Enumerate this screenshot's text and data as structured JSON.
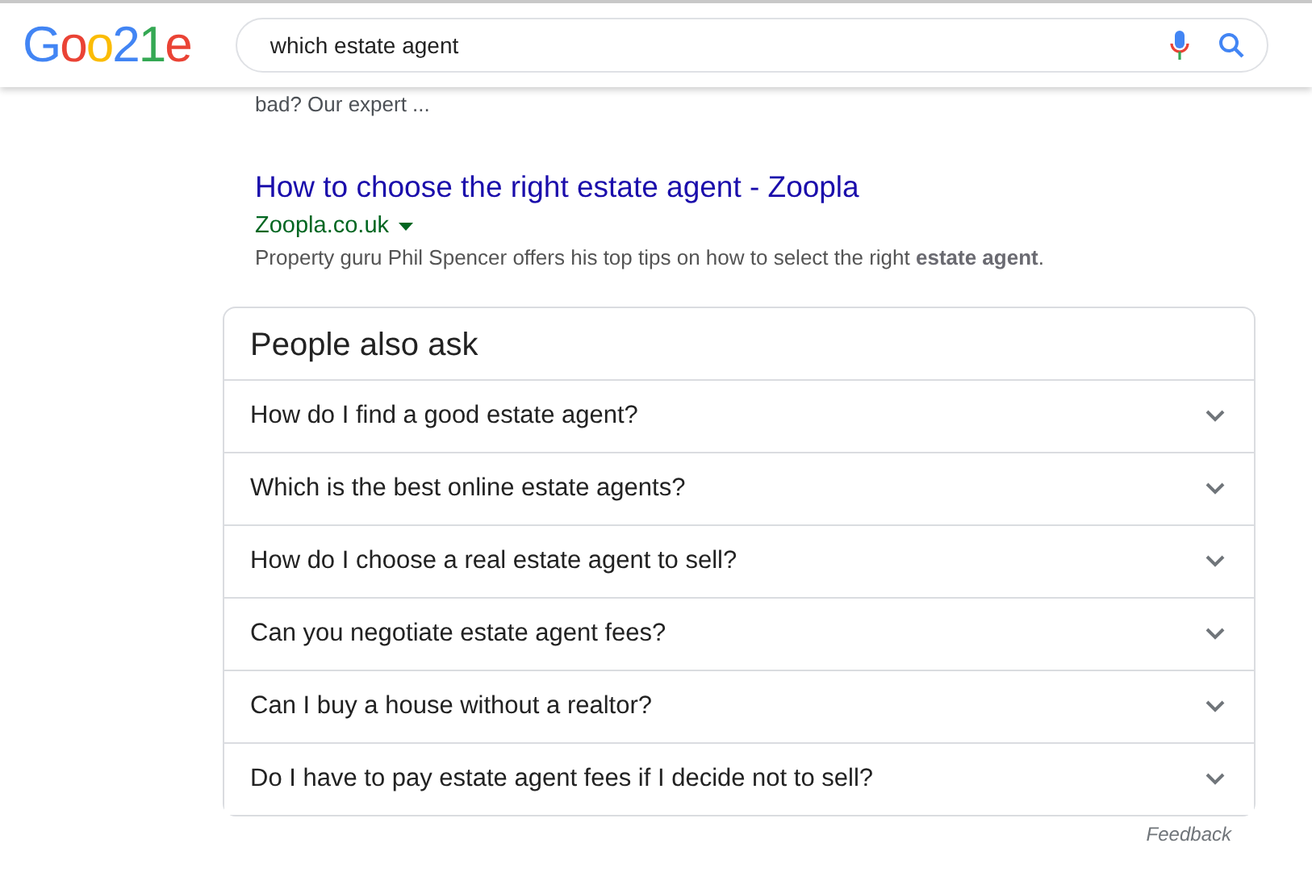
{
  "logo": {
    "letters": [
      {
        "char": "G",
        "color": "#4285f4"
      },
      {
        "char": "o",
        "color": "#ea4335"
      },
      {
        "char": "o",
        "color": "#fbbc05"
      },
      {
        "char": "2",
        "color": "#4285f4"
      },
      {
        "char": "1",
        "color": "#34a853"
      },
      {
        "char": "e",
        "color": "#ea4335"
      }
    ]
  },
  "search": {
    "value": "which estate agent"
  },
  "prev_snippet": "bad? Our expert ...",
  "result": {
    "title": "How to choose the right estate agent - Zoopla",
    "url": "Zoopla.co.uk",
    "snippet": "Property guru Phil Spencer offers his top tips on how to select the right **estate agent**."
  },
  "people_also_ask": {
    "title": "People also ask",
    "questions": [
      {
        "text": "How do I find a good estate agent?",
        "expanded": false
      },
      {
        "text": "Which is the best online estate agents?",
        "expanded": false
      },
      {
        "text": "How do I choose a real estate agent to sell?",
        "expanded": false
      },
      {
        "text": "Can you negotiate estate agent fees?",
        "expanded": false
      },
      {
        "text": "Can I buy a house without a realtor?",
        "expanded": false
      },
      {
        "text": "Do I have to pay estate agent fees if I decide not to sell?",
        "expanded": false
      }
    ]
  },
  "feedback": "Feedback"
}
